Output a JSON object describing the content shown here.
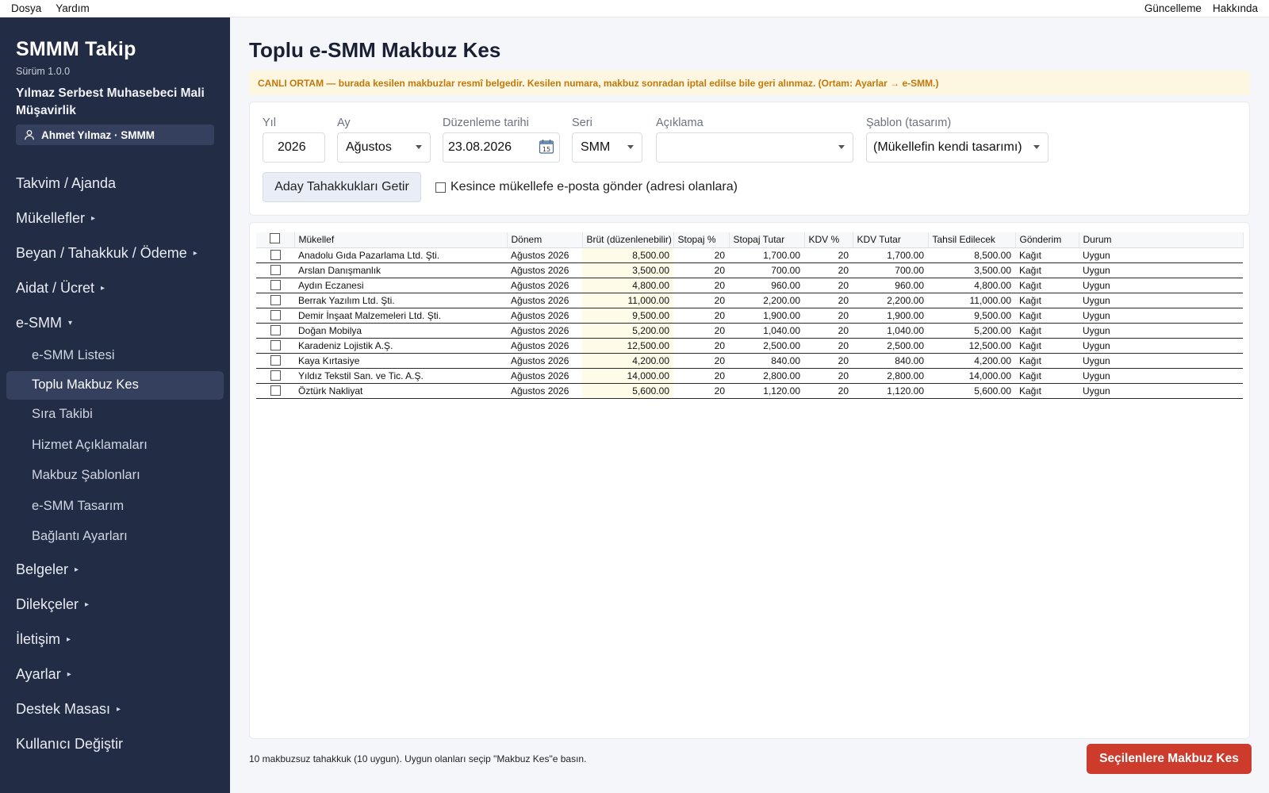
{
  "menubar": {
    "left": [
      "Dosya",
      "Yardım"
    ],
    "right": [
      "Güncelleme",
      "Hakkında"
    ]
  },
  "sidebar": {
    "app_title": "SMMM Takip",
    "version": "Sürüm 1.0.0",
    "firm": "Yılmaz Serbest Muhasebeci Mali Müşavirlik",
    "user": "Ahmet Yılmaz · SMMM",
    "nav": [
      {
        "label": "Takvim / Ajanda",
        "arrow": ""
      },
      {
        "label": "Mükellefler",
        "arrow": "▸"
      },
      {
        "label": "Beyan / Tahakkuk / Ödeme",
        "arrow": "▸"
      },
      {
        "label": "Aidat / Ücret",
        "arrow": "▸"
      },
      {
        "label": "e-SMM",
        "arrow": "▾"
      }
    ],
    "sub": [
      {
        "label": "e-SMM Listesi"
      },
      {
        "label": "Toplu Makbuz Kes"
      },
      {
        "label": "Sıra Takibi"
      },
      {
        "label": "Hizmet Açıklamaları"
      },
      {
        "label": "Makbuz Şablonları"
      },
      {
        "label": "e-SMM Tasarım"
      },
      {
        "label": "Bağlantı Ayarları"
      }
    ],
    "nav2": [
      {
        "label": "Belgeler",
        "arrow": "▸"
      },
      {
        "label": "Dilekçeler",
        "arrow": "▸"
      },
      {
        "label": "İletişim",
        "arrow": "▸"
      },
      {
        "label": "Ayarlar",
        "arrow": "▸"
      },
      {
        "label": "Destek Masası",
        "arrow": "▸"
      },
      {
        "label": "Kullanıcı Değiştir",
        "arrow": ""
      }
    ]
  },
  "main": {
    "title": "Toplu e-SMM Makbuz Kes",
    "warning": "CANLI ORTAM — burada kesilen makbuzlar resmî belgedir. Kesilen numara, makbuz sonradan iptal edilse bile geri alınmaz. (Ortam: Ayarlar → e-SMM.)",
    "filters": {
      "year_label": "Yıl",
      "year_value": "2026",
      "month_label": "Ay",
      "month_value": "Ağustos",
      "date_label": "Düzenleme tarihi",
      "date_value": "23.08.2026",
      "series_label": "Seri",
      "series_value": "SMM",
      "desc_label": "Açıklama",
      "desc_value": "",
      "template_label": "Şablon (tasarım)",
      "template_value": "(Mükellefin kendi tasarımı)",
      "fetch_button": "Aday Tahakkukları Getir",
      "email_label": "Kesince mükellefe e-posta gönder (adresi olanlara)"
    },
    "table": {
      "headers": [
        "Mükellef",
        "Dönem",
        "Brüt (düzenlenebilir)",
        "Stopaj %",
        "Stopaj Tutar",
        "KDV %",
        "KDV Tutar",
        "Tahsil Edilecek",
        "Gönderim",
        "Durum"
      ],
      "rows": [
        [
          "Anadolu Gıda Pazarlama Ltd. Şti.",
          "Ağustos 2026",
          "8,500.00",
          "20",
          "1,700.00",
          "20",
          "1,700.00",
          "8,500.00",
          "Kağıt",
          "Uygun"
        ],
        [
          "Arslan Danışmanlık",
          "Ağustos 2026",
          "3,500.00",
          "20",
          "700.00",
          "20",
          "700.00",
          "3,500.00",
          "Kağıt",
          "Uygun"
        ],
        [
          "Aydın Eczanesi",
          "Ağustos 2026",
          "4,800.00",
          "20",
          "960.00",
          "20",
          "960.00",
          "4,800.00",
          "Kağıt",
          "Uygun"
        ],
        [
          "Berrak Yazılım Ltd. Şti.",
          "Ağustos 2026",
          "11,000.00",
          "20",
          "2,200.00",
          "20",
          "2,200.00",
          "11,000.00",
          "Kağıt",
          "Uygun"
        ],
        [
          "Demir İnşaat Malzemeleri Ltd. Şti.",
          "Ağustos 2026",
          "9,500.00",
          "20",
          "1,900.00",
          "20",
          "1,900.00",
          "9,500.00",
          "Kağıt",
          "Uygun"
        ],
        [
          "Doğan Mobilya",
          "Ağustos 2026",
          "5,200.00",
          "20",
          "1,040.00",
          "20",
          "1,040.00",
          "5,200.00",
          "Kağıt",
          "Uygun"
        ],
        [
          "Karadeniz Lojistik A.Ş.",
          "Ağustos 2026",
          "12,500.00",
          "20",
          "2,500.00",
          "20",
          "2,500.00",
          "12,500.00",
          "Kağıt",
          "Uygun"
        ],
        [
          "Kaya Kırtasiye",
          "Ağustos 2026",
          "4,200.00",
          "20",
          "840.00",
          "20",
          "840.00",
          "4,200.00",
          "Kağıt",
          "Uygun"
        ],
        [
          "Yıldız Tekstil San. ve Tic. A.Ş.",
          "Ağustos 2026",
          "14,000.00",
          "20",
          "2,800.00",
          "20",
          "2,800.00",
          "14,000.00",
          "Kağıt",
          "Uygun"
        ],
        [
          "Öztürk Nakliyat",
          "Ağustos 2026",
          "5,600.00",
          "20",
          "1,120.00",
          "20",
          "1,120.00",
          "5,600.00",
          "Kağıt",
          "Uygun"
        ]
      ]
    },
    "footer_text": "10 makbuzsuz tahakkuk (10 uygun). Uygun olanları seçip \"Makbuz Kes\"e basın.",
    "submit_button": "Seçilenlere Makbuz Kes"
  },
  "colors": {
    "sidebar_bg": "#222c45",
    "active_bg": "#34405e",
    "primary": "#cc3b2c",
    "warning_text": "#c2790a",
    "warning_bg": "#fdf6e0"
  }
}
